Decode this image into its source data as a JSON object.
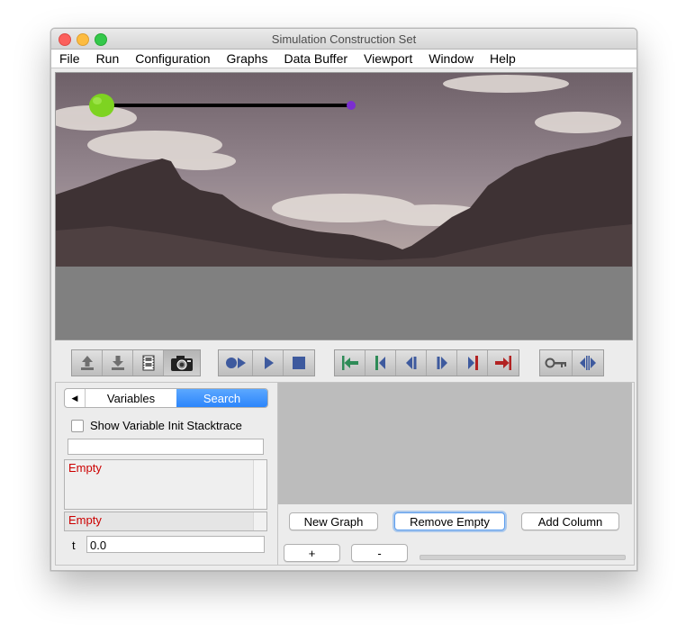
{
  "window": {
    "title": "Simulation Construction Set"
  },
  "menu": {
    "items": [
      "File",
      "Run",
      "Configuration",
      "Graphs",
      "Data Buffer",
      "Viewport",
      "Window",
      "Help"
    ]
  },
  "colors": {
    "sky": "#8a7c83",
    "ground": "#808080",
    "mountain": "#3d3133",
    "ball": "#7ed321",
    "mass": "#7b2fd0",
    "tab_active": "#2c85fb",
    "empty_text": "#cc0000",
    "graph_bg": "#bcbcbc"
  },
  "toolbar": {
    "groups": [
      [
        "export-icon",
        "import-icon",
        "film-icon",
        "camera-icon"
      ],
      [
        "play-sim-icon",
        "play-icon",
        "stop-icon"
      ],
      [
        "goto-in-point-icon",
        "step-to-in-icon",
        "step-backward-icon",
        "step-forward-icon",
        "step-to-out-icon",
        "goto-out-point-icon"
      ],
      [
        "key-icon",
        "zoom-icon"
      ]
    ]
  },
  "variables_panel": {
    "tab_back": "◀",
    "tab_variables": "Variables",
    "tab_search": "Search",
    "show_stacktrace_label": "Show Variable Init Stacktrace",
    "search_value": "",
    "list_empty": "Empty",
    "list2_empty": "Empty",
    "t_label": "t",
    "t_value": "0.0"
  },
  "graph_panel": {
    "new_graph": "New Graph",
    "remove_empty": "Remove Empty",
    "add_column": "Add Column",
    "plus": "+",
    "minus": "-"
  }
}
